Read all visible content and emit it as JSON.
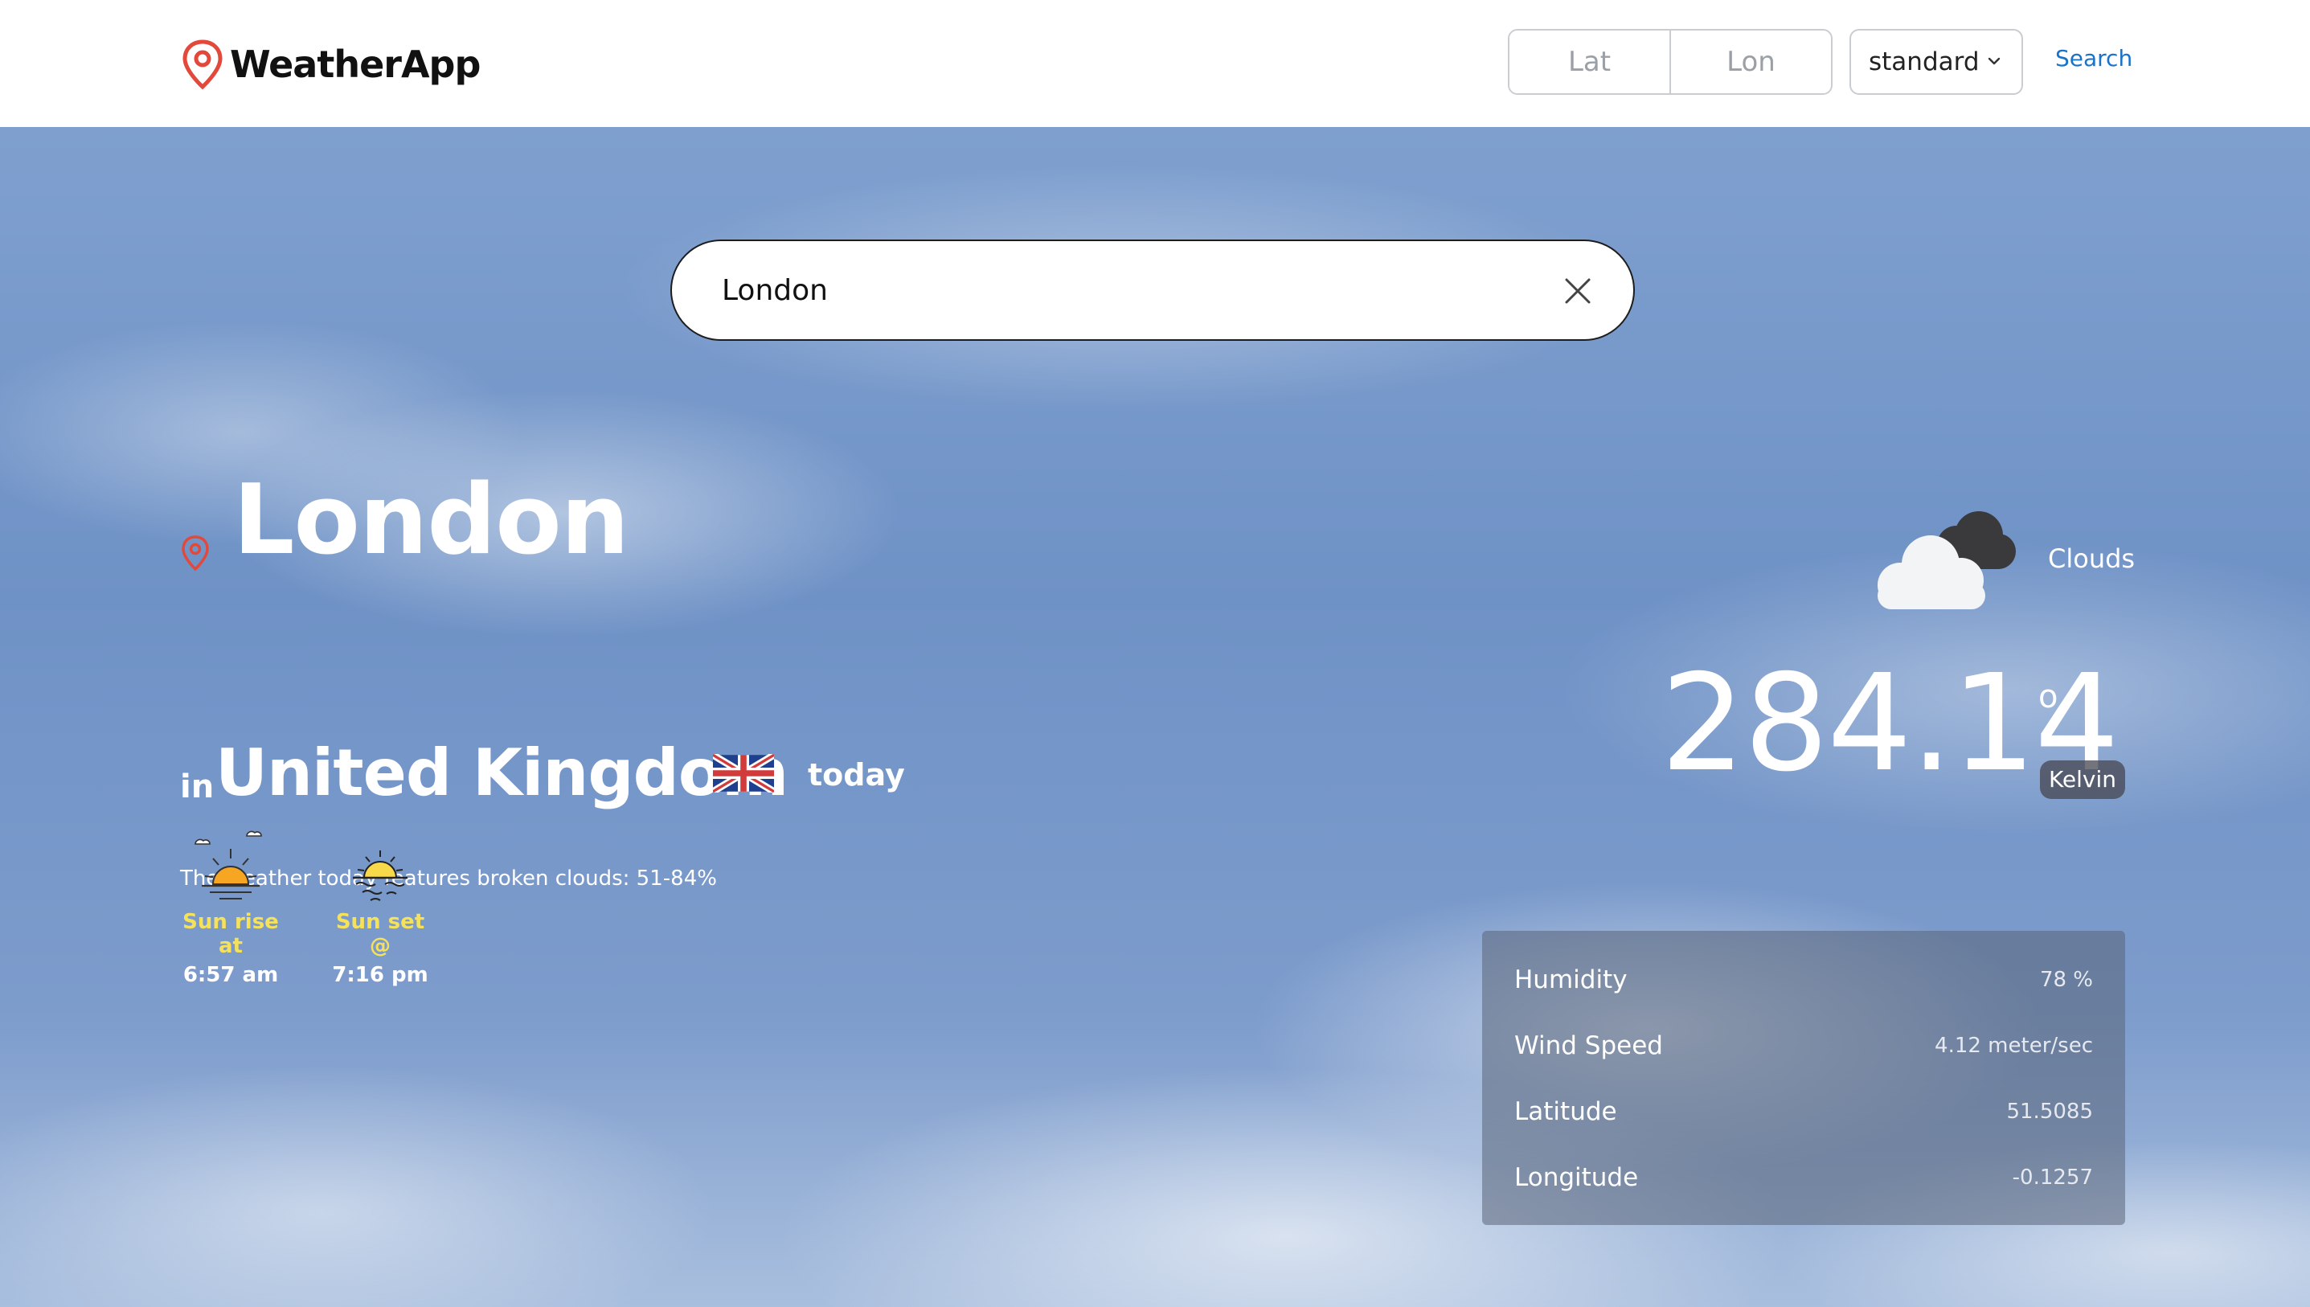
{
  "header": {
    "brand_name": "WeatherApp",
    "lat_placeholder": "Lat",
    "lon_placeholder": "Lon",
    "unit_selected": "standard",
    "search_label": "Search"
  },
  "search": {
    "value": "London"
  },
  "location": {
    "city": "London",
    "in_label": "in",
    "country": "United Kingdom",
    "today_label": "today"
  },
  "description": "The weather today features broken clouds: 51-84%",
  "sun": {
    "sunrise_label": "Sun rise at",
    "sunrise_time": "6:57 am",
    "sunset_label": "Sun set @",
    "sunset_time": "7:16 pm"
  },
  "current": {
    "condition": "Clouds",
    "temperature": "284.14",
    "degree_symbol": "o",
    "unit": "Kelvin"
  },
  "details": [
    {
      "label": "Humidity",
      "value": "78 %"
    },
    {
      "label": "Wind Speed",
      "value": "4.12 meter/sec"
    },
    {
      "label": "Latitude",
      "value": "51.5085"
    },
    {
      "label": "Longitude",
      "value": "-0.1257"
    }
  ],
  "icons": {
    "brand": "map-pin-icon",
    "clear": "close-icon",
    "location": "map-pin-icon",
    "flag": "uk-flag-icon",
    "sunrise": "sunrise-icon",
    "sunset": "sunset-icon",
    "weather": "cloud-icon",
    "select": "chevron-down-icon"
  },
  "colors": {
    "accent_red": "#e2493b",
    "link_blue": "#1a73c9",
    "sun_label_yellow": "#f6e25a"
  }
}
